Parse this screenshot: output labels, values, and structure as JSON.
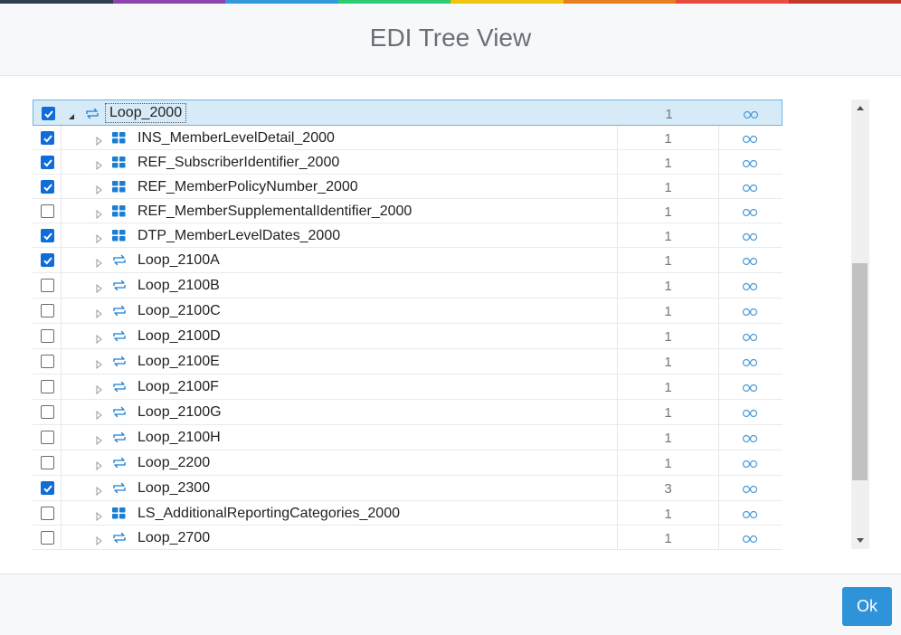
{
  "top_stripe_colors": [
    "#2c3e50",
    "#8e44ad",
    "#3498db",
    "#2ecc71",
    "#f1c40f",
    "#e67e22",
    "#e74c3c",
    "#c0392b"
  ],
  "dialog": {
    "title": "EDI Tree View"
  },
  "colors": {
    "accent": "#2e93d8",
    "checkbox": "#0f6cd8",
    "selected_row": "#d6ebf7",
    "icon_blue": "#1a7ed3"
  },
  "tree": {
    "rows": [
      {
        "checked": true,
        "expanded": true,
        "icon": "loop-icon",
        "label": "Loop_2000",
        "count": "1",
        "selected": true,
        "level": 0
      },
      {
        "checked": true,
        "expanded": false,
        "icon": "segment-icon",
        "label": "INS_MemberLevelDetail_2000",
        "count": "1",
        "level": 1
      },
      {
        "checked": true,
        "expanded": false,
        "icon": "segment-icon",
        "label": "REF_SubscriberIdentifier_2000",
        "count": "1",
        "level": 1
      },
      {
        "checked": true,
        "expanded": false,
        "icon": "segment-icon",
        "label": "REF_MemberPolicyNumber_2000",
        "count": "1",
        "level": 1
      },
      {
        "checked": false,
        "expanded": false,
        "icon": "segment-icon",
        "label": "REF_MemberSupplementalIdentifier_2000",
        "count": "1",
        "level": 1
      },
      {
        "checked": true,
        "expanded": false,
        "icon": "segment-icon",
        "label": "DTP_MemberLevelDates_2000",
        "count": "1",
        "level": 1
      },
      {
        "checked": true,
        "expanded": false,
        "icon": "loop-icon",
        "label": "Loop_2100A",
        "count": "1",
        "level": 1
      },
      {
        "checked": false,
        "expanded": false,
        "icon": "loop-icon",
        "label": "Loop_2100B",
        "count": "1",
        "level": 1
      },
      {
        "checked": false,
        "expanded": false,
        "icon": "loop-icon",
        "label": "Loop_2100C",
        "count": "1",
        "level": 1
      },
      {
        "checked": false,
        "expanded": false,
        "icon": "loop-icon",
        "label": "Loop_2100D",
        "count": "1",
        "level": 1
      },
      {
        "checked": false,
        "expanded": false,
        "icon": "loop-icon",
        "label": "Loop_2100E",
        "count": "1",
        "level": 1
      },
      {
        "checked": false,
        "expanded": false,
        "icon": "loop-icon",
        "label": "Loop_2100F",
        "count": "1",
        "level": 1
      },
      {
        "checked": false,
        "expanded": false,
        "icon": "loop-icon",
        "label": "Loop_2100G",
        "count": "1",
        "level": 1
      },
      {
        "checked": false,
        "expanded": false,
        "icon": "loop-icon",
        "label": "Loop_2100H",
        "count": "1",
        "level": 1
      },
      {
        "checked": false,
        "expanded": false,
        "icon": "loop-icon",
        "label": "Loop_2200",
        "count": "1",
        "level": 1
      },
      {
        "checked": true,
        "expanded": false,
        "icon": "loop-icon",
        "label": "Loop_2300",
        "count": "3",
        "level": 1
      },
      {
        "checked": false,
        "expanded": false,
        "icon": "segment-icon",
        "label": "LS_AdditionalReportingCategories_2000",
        "count": "1",
        "level": 1
      },
      {
        "checked": false,
        "expanded": false,
        "icon": "loop-icon",
        "label": "Loop_2700",
        "count": "1",
        "level": 1
      }
    ]
  },
  "footer": {
    "ok_label": "Ok"
  }
}
